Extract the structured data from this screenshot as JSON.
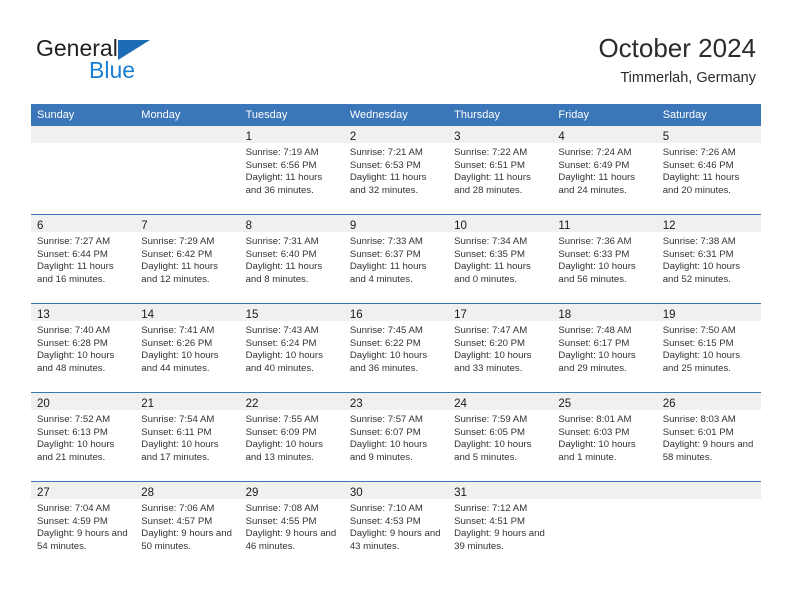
{
  "brand": {
    "name_top": "General",
    "name_bottom": "Blue",
    "triangle_icon": "blue-triangle-icon",
    "color_dark": "#231f20",
    "color_blue": "#1b7fd4"
  },
  "header": {
    "title": "October 2024",
    "subtitle": "Timmerlah, Germany"
  },
  "theme": {
    "header_blue": "#3a76b8",
    "daynum_band": "#f0f0f0",
    "grid_line": "#3a76b8",
    "text": "#333333"
  },
  "weekday_headers": [
    "Sunday",
    "Monday",
    "Tuesday",
    "Wednesday",
    "Thursday",
    "Friday",
    "Saturday"
  ],
  "weeks": [
    [
      {
        "day": "",
        "info": ""
      },
      {
        "day": "",
        "info": ""
      },
      {
        "day": "1",
        "info": "Sunrise: 7:19 AM\nSunset: 6:56 PM\nDaylight: 11 hours and 36 minutes."
      },
      {
        "day": "2",
        "info": "Sunrise: 7:21 AM\nSunset: 6:53 PM\nDaylight: 11 hours and 32 minutes."
      },
      {
        "day": "3",
        "info": "Sunrise: 7:22 AM\nSunset: 6:51 PM\nDaylight: 11 hours and 28 minutes."
      },
      {
        "day": "4",
        "info": "Sunrise: 7:24 AM\nSunset: 6:49 PM\nDaylight: 11 hours and 24 minutes."
      },
      {
        "day": "5",
        "info": "Sunrise: 7:26 AM\nSunset: 6:46 PM\nDaylight: 11 hours and 20 minutes."
      }
    ],
    [
      {
        "day": "6",
        "info": "Sunrise: 7:27 AM\nSunset: 6:44 PM\nDaylight: 11 hours and 16 minutes."
      },
      {
        "day": "7",
        "info": "Sunrise: 7:29 AM\nSunset: 6:42 PM\nDaylight: 11 hours and 12 minutes."
      },
      {
        "day": "8",
        "info": "Sunrise: 7:31 AM\nSunset: 6:40 PM\nDaylight: 11 hours and 8 minutes."
      },
      {
        "day": "9",
        "info": "Sunrise: 7:33 AM\nSunset: 6:37 PM\nDaylight: 11 hours and 4 minutes."
      },
      {
        "day": "10",
        "info": "Sunrise: 7:34 AM\nSunset: 6:35 PM\nDaylight: 11 hours and 0 minutes."
      },
      {
        "day": "11",
        "info": "Sunrise: 7:36 AM\nSunset: 6:33 PM\nDaylight: 10 hours and 56 minutes."
      },
      {
        "day": "12",
        "info": "Sunrise: 7:38 AM\nSunset: 6:31 PM\nDaylight: 10 hours and 52 minutes."
      }
    ],
    [
      {
        "day": "13",
        "info": "Sunrise: 7:40 AM\nSunset: 6:28 PM\nDaylight: 10 hours and 48 minutes."
      },
      {
        "day": "14",
        "info": "Sunrise: 7:41 AM\nSunset: 6:26 PM\nDaylight: 10 hours and 44 minutes."
      },
      {
        "day": "15",
        "info": "Sunrise: 7:43 AM\nSunset: 6:24 PM\nDaylight: 10 hours and 40 minutes."
      },
      {
        "day": "16",
        "info": "Sunrise: 7:45 AM\nSunset: 6:22 PM\nDaylight: 10 hours and 36 minutes."
      },
      {
        "day": "17",
        "info": "Sunrise: 7:47 AM\nSunset: 6:20 PM\nDaylight: 10 hours and 33 minutes."
      },
      {
        "day": "18",
        "info": "Sunrise: 7:48 AM\nSunset: 6:17 PM\nDaylight: 10 hours and 29 minutes."
      },
      {
        "day": "19",
        "info": "Sunrise: 7:50 AM\nSunset: 6:15 PM\nDaylight: 10 hours and 25 minutes."
      }
    ],
    [
      {
        "day": "20",
        "info": "Sunrise: 7:52 AM\nSunset: 6:13 PM\nDaylight: 10 hours and 21 minutes."
      },
      {
        "day": "21",
        "info": "Sunrise: 7:54 AM\nSunset: 6:11 PM\nDaylight: 10 hours and 17 minutes."
      },
      {
        "day": "22",
        "info": "Sunrise: 7:55 AM\nSunset: 6:09 PM\nDaylight: 10 hours and 13 minutes."
      },
      {
        "day": "23",
        "info": "Sunrise: 7:57 AM\nSunset: 6:07 PM\nDaylight: 10 hours and 9 minutes."
      },
      {
        "day": "24",
        "info": "Sunrise: 7:59 AM\nSunset: 6:05 PM\nDaylight: 10 hours and 5 minutes."
      },
      {
        "day": "25",
        "info": "Sunrise: 8:01 AM\nSunset: 6:03 PM\nDaylight: 10 hours and 1 minute."
      },
      {
        "day": "26",
        "info": "Sunrise: 8:03 AM\nSunset: 6:01 PM\nDaylight: 9 hours and 58 minutes."
      }
    ],
    [
      {
        "day": "27",
        "info": "Sunrise: 7:04 AM\nSunset: 4:59 PM\nDaylight: 9 hours and 54 minutes."
      },
      {
        "day": "28",
        "info": "Sunrise: 7:06 AM\nSunset: 4:57 PM\nDaylight: 9 hours and 50 minutes."
      },
      {
        "day": "29",
        "info": "Sunrise: 7:08 AM\nSunset: 4:55 PM\nDaylight: 9 hours and 46 minutes."
      },
      {
        "day": "30",
        "info": "Sunrise: 7:10 AM\nSunset: 4:53 PM\nDaylight: 9 hours and 43 minutes."
      },
      {
        "day": "31",
        "info": "Sunrise: 7:12 AM\nSunset: 4:51 PM\nDaylight: 9 hours and 39 minutes."
      },
      {
        "day": "",
        "info": ""
      },
      {
        "day": "",
        "info": ""
      }
    ]
  ]
}
